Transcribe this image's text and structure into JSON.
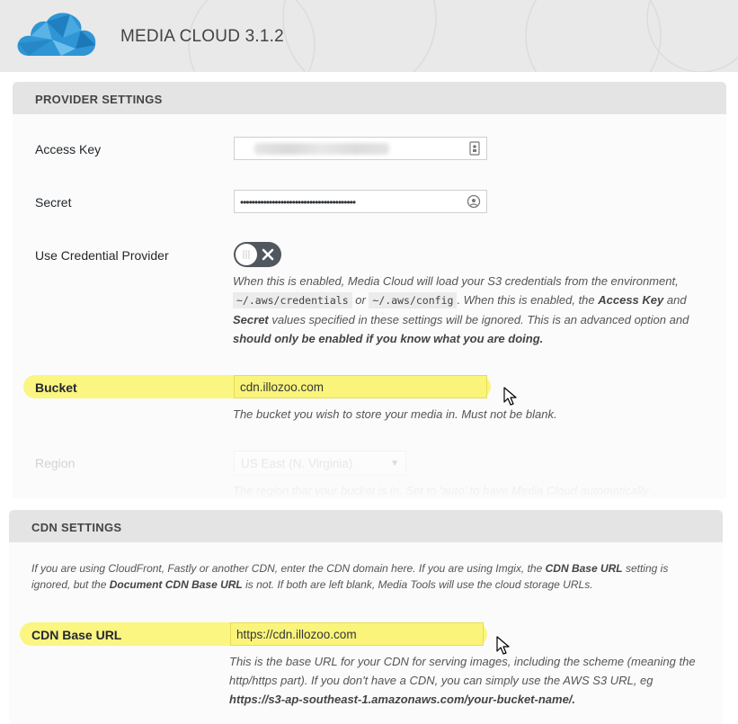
{
  "header": {
    "title": "MEDIA CLOUD 3.1.2"
  },
  "provider": {
    "title": "PROVIDER SETTINGS",
    "access_key": {
      "label": "Access Key"
    },
    "secret": {
      "label": "Secret",
      "value": "••••••••••••••••••••••••••••••••••••••••"
    },
    "credential_provider": {
      "label": "Use Credential Provider",
      "desc": {
        "p1": "When this is enabled, Media Cloud will load your S3 credentials from the environment, ",
        "code1": "~/.aws/credentials",
        "p2": " or ",
        "code2": "~/.aws/config",
        "p3": ". When this is enabled, the ",
        "b1": "Access Key",
        "p4": " and ",
        "b2": "Secret",
        "p5": " values specified in these settings will be ignored. This is an advanced option and ",
        "b3": "should only be enabled if you know what you are doing."
      }
    },
    "bucket": {
      "label": "Bucket",
      "value": "cdn.illozoo.com",
      "desc": "The bucket you wish to store your media in. Must not be blank."
    },
    "region": {
      "label": "Region",
      "value": "US East (N. Virginia)",
      "desc": "The region that your bucket is in. Set to 'auto' to have Media Cloud automatically"
    }
  },
  "cdn": {
    "title": "CDN SETTINGS",
    "intro": {
      "p1": "If you are using CloudFront, Fastly or another CDN, enter the CDN domain here. If you are using Imgix, the ",
      "b1": "CDN Base URL",
      "p2": " setting is ignored, but the ",
      "b2": "Document CDN Base URL",
      "p3": " is not. If both are left blank, Media Tools will use the cloud storage URLs."
    },
    "base_url": {
      "label": "CDN Base URL",
      "value": "https://cdn.illozoo.com",
      "desc": {
        "p1": "This is the base URL for your CDN for serving images, including the scheme (meaning the http/https part). If you don't have a CDN, you can simply use the AWS S3 URL, eg ",
        "b1": "https://s3-ap-southeast-1.amazonaws.com/your-bucket-name/."
      }
    }
  },
  "colors": {
    "highlight": "#fbf47a",
    "toggle": "#50575e",
    "panel_head": "#e4e4e4"
  }
}
